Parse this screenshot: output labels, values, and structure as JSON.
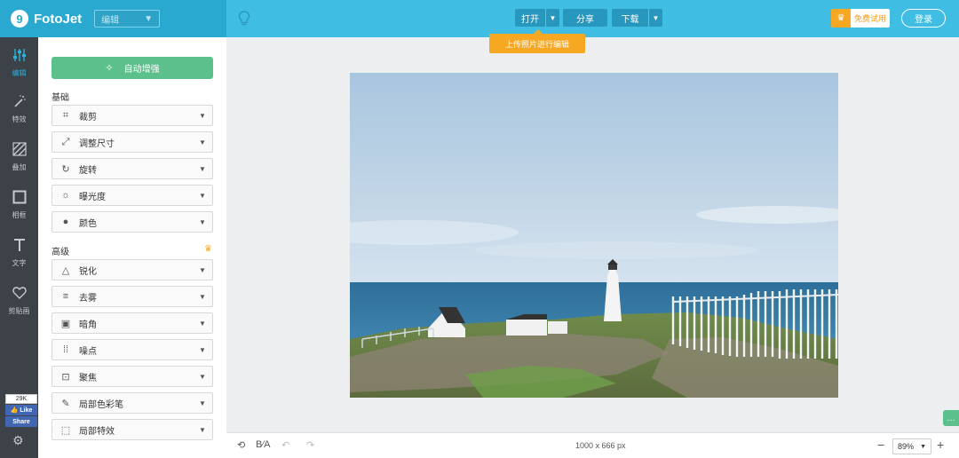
{
  "app": {
    "logo": "FotoJet",
    "mode": "编辑"
  },
  "toolbar": {
    "open_label": "打开",
    "share_label": "分享",
    "download_label": "下载",
    "tooltip": "上传照片进行编辑",
    "trial_label": "免费试用",
    "login_label": "登录"
  },
  "nav": [
    {
      "label": "编辑",
      "icon": "sliders-icon"
    },
    {
      "label": "特效",
      "icon": "magic-wand-icon"
    },
    {
      "label": "叠加",
      "icon": "overlay-icon"
    },
    {
      "label": "相框",
      "icon": "frame-icon"
    },
    {
      "label": "文字",
      "icon": "text-icon"
    },
    {
      "label": "剪贴画",
      "icon": "heart-icon"
    }
  ],
  "facebook": {
    "count": "29K",
    "like": "Like",
    "share": "Share"
  },
  "panel": {
    "auto_enhance": "自动增强",
    "basic_title": "基础",
    "basic_tools": [
      "裁剪",
      "调整尺寸",
      "旋转",
      "曝光度",
      "颜色"
    ],
    "advanced_title": "高级",
    "advanced_tools": [
      "锐化",
      "去雾",
      "暗角",
      "噪点",
      "聚焦",
      "局部色彩笔",
      "局部特效"
    ]
  },
  "canvas": {
    "dimensions": "1000 x 666 px",
    "zoom": "89%"
  },
  "colors": {
    "accent": "#3fbde3",
    "enhance": "#5cc08d",
    "highlight": "#f7a823"
  }
}
